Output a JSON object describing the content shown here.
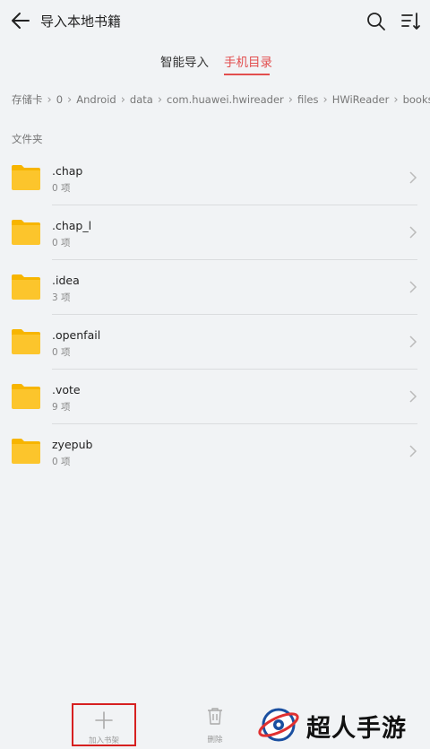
{
  "header": {
    "title": "导入本地书籍",
    "icons": [
      "back-arrow-icon",
      "search-icon",
      "sort-icon"
    ]
  },
  "tabs": [
    {
      "label": "智能导入",
      "active": false
    },
    {
      "label": "手机目录",
      "active": true
    }
  ],
  "accent_color": "#e24e4e",
  "breadcrumb": [
    "存储卡",
    "0",
    "Android",
    "data",
    "com.huawei.hwireader",
    "files",
    "HWiReader",
    "books"
  ],
  "section_label": "文件夹",
  "folders": [
    {
      "name": ".chap",
      "count": "0 项"
    },
    {
      "name": ".chap_l",
      "count": "0 项"
    },
    {
      "name": ".idea",
      "count": "3 项"
    },
    {
      "name": ".openfail",
      "count": "0 项"
    },
    {
      "name": ".vote",
      "count": "9 项"
    },
    {
      "name": "zyepub",
      "count": "0 项"
    }
  ],
  "bottom_bar": {
    "add_label": "加入书架",
    "delete_label": "删除"
  },
  "watermark": {
    "text": "超人手游网"
  }
}
